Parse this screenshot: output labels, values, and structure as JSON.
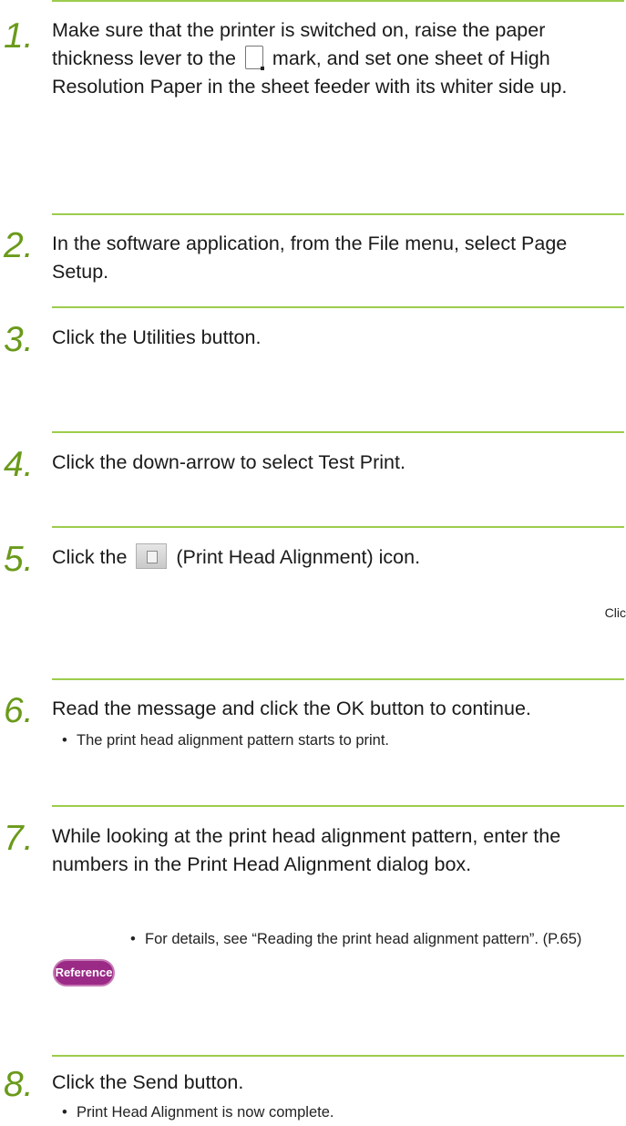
{
  "steps": [
    {
      "num": "1.",
      "pre": "Make sure that the printer is switched on, raise the paper thickness lever to the",
      "post": "mark, and set one sheet of High Resolution Paper in the sheet feeder with its whiter side up."
    },
    {
      "num": "2.",
      "text": "In the software application, from the File menu, select Page Setup."
    },
    {
      "num": "3.",
      "text": "Click the Utilities button."
    },
    {
      "num": "4.",
      "text": "Click the down-arrow to select Test Print."
    },
    {
      "num": "5.",
      "pre": "Click the",
      "post": "(Print Head Alignment) icon."
    },
    {
      "num": "6.",
      "text": "Read the message and click the OK button to continue.",
      "bullet": "The print head alignment pattern starts to print."
    },
    {
      "num": "7.",
      "text": "While looking at the print head alignment pattern, enter the numbers in the Print Head Alignment dialog box."
    },
    {
      "num": "8.",
      "text": "Click the Send button.",
      "bullet": "Print Head Alignment is now complete."
    }
  ],
  "side_text": "Clic",
  "reference": {
    "badge": "Reference",
    "bullet": "For details, see “Reading the print head alignment pattern”. (P.65)"
  },
  "bullet_char": "•",
  "colors": {
    "rule": "#9ccc4c",
    "number": "#6a9a1a",
    "badge": "#9b2a86"
  },
  "icons": [
    "paper-thickness-icon",
    "print-head-alignment-icon"
  ]
}
